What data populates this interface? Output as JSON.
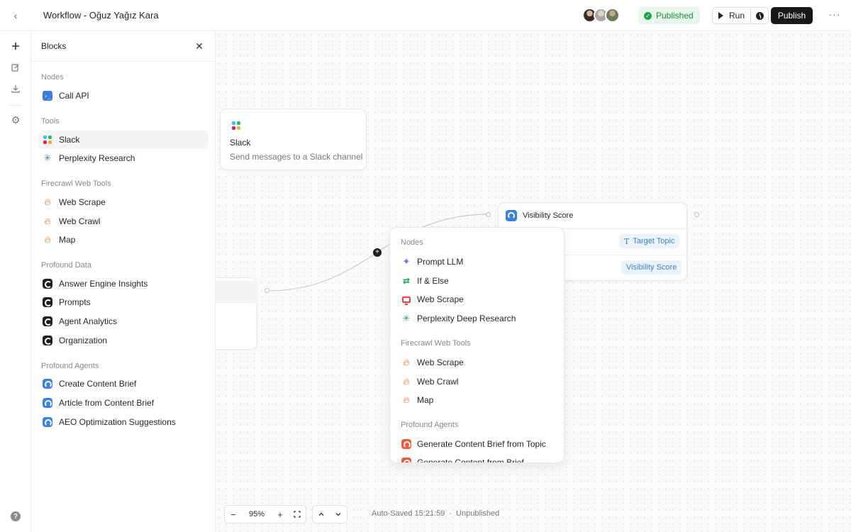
{
  "header": {
    "back_icon": "chevron-left-icon",
    "title": "Workflow - Oğuz Yağız Kara",
    "status_badge": "Published",
    "run_label": "Run",
    "publish_label": "Publish",
    "more_icon": "more-horizontal-icon"
  },
  "rail": {
    "items": [
      "plus-icon",
      "edit-icon",
      "download-icon",
      "gear-icon"
    ],
    "help_icon": "help-icon"
  },
  "blocks_panel": {
    "title": "Blocks",
    "sections": [
      {
        "label": "Nodes",
        "items": [
          {
            "label": "Call API",
            "icon": "terminal-icon"
          }
        ]
      },
      {
        "label": "Tools",
        "items": [
          {
            "label": "Slack",
            "icon": "slack-icon"
          },
          {
            "label": "Perplexity Research",
            "icon": "perplexity-icon"
          }
        ]
      },
      {
        "label": "Firecrawl Web Tools",
        "items": [
          {
            "label": "Web Scrape",
            "icon": "flame-icon"
          },
          {
            "label": "Web Crawl",
            "icon": "flame-icon"
          },
          {
            "label": "Map",
            "icon": "flame-icon"
          }
        ]
      },
      {
        "label": "Profound Data",
        "items": [
          {
            "label": "Answer Engine Insights",
            "icon": "profound-icon"
          },
          {
            "label": "Prompts",
            "icon": "profound-icon"
          },
          {
            "label": "Agent Analytics",
            "icon": "profound-icon"
          },
          {
            "label": "Organization",
            "icon": "profound-icon"
          }
        ]
      },
      {
        "label": "Profound Agents",
        "items": [
          {
            "label": "Create Content Brief",
            "icon": "agent-icon"
          },
          {
            "label": "Article from Content Brief",
            "icon": "agent-icon"
          },
          {
            "label": "AEO Optimization Suggestions",
            "icon": "agent-icon"
          }
        ]
      }
    ]
  },
  "canvas": {
    "slack_node": {
      "title": "Slack",
      "description": "Send messages to a Slack channel"
    },
    "visibility_node": {
      "title": "Visibility Score",
      "chip_topic": "Target Topic",
      "chip_score": "Visibility Score"
    },
    "picker": {
      "sections": [
        {
          "label": "Nodes",
          "items": [
            {
              "label": "Prompt LLM",
              "icon": "sparkle-icon"
            },
            {
              "label": "If & Else",
              "icon": "branch-icon"
            },
            {
              "label": "Web Scrape",
              "icon": "monitor-icon"
            },
            {
              "label": "Perplexity Deep Research",
              "icon": "perplexity-icon"
            }
          ]
        },
        {
          "label": "Firecrawl Web Tools",
          "items": [
            {
              "label": "Web Scrape",
              "icon": "flame-icon"
            },
            {
              "label": "Web Crawl",
              "icon": "flame-icon"
            },
            {
              "label": "Map",
              "icon": "flame-icon"
            }
          ]
        },
        {
          "label": "Profound Agents",
          "items": [
            {
              "label": "Generate Content Brief from Topic",
              "icon": "agent-icon"
            },
            {
              "label": "Generate Content from Brief",
              "icon": "agent-icon"
            }
          ]
        }
      ]
    }
  },
  "footer": {
    "zoom": "95%",
    "saved": "Auto-Saved 15:21:59",
    "dot": "·",
    "state": "Unpublished"
  },
  "colors": {
    "published_bg": "#e8f6ec",
    "published_text": "#1a8a3c",
    "chip_bg": "#eaf3fc",
    "chip_text": "#3b82c4",
    "flame": "#f26a1b",
    "publish_bg": "#18181b"
  }
}
